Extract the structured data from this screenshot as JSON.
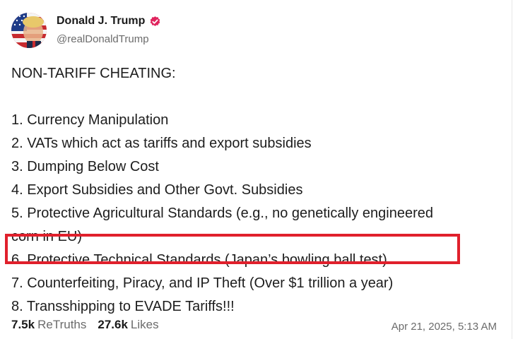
{
  "author": {
    "display_name": "Donald J. Trump",
    "handle": "@realDonaldTrump",
    "verified_icon": "verified-badge-icon",
    "verified_color": "#e0245e"
  },
  "post": {
    "lines": [
      "NON-TARIFF CHEATING:",
      "",
      "1. Currency Manipulation",
      "2. VATs which act as tariffs and export subsidies",
      "3. Dumping Below Cost",
      "4. Export Subsidies and Other Govt. Subsidies",
      "5. Protective Agricultural Standards (e.g., no genetically engineered",
      "corn in EU)",
      "6. Protective Technical Standards (Japan’s bowling ball test)",
      "7. Counterfeiting, Piracy, and IP Theft (Over $1 trillion a year)",
      "8. Transshipping to EVADE Tariffs!!!"
    ],
    "highlight_color": "#e0202c"
  },
  "stats": {
    "retruths_count": "7.5k",
    "retruths_label": "ReTruths",
    "likes_count": "27.6k",
    "likes_label": "Likes"
  },
  "timestamp": "Apr 21, 2025, 5:13 AM"
}
